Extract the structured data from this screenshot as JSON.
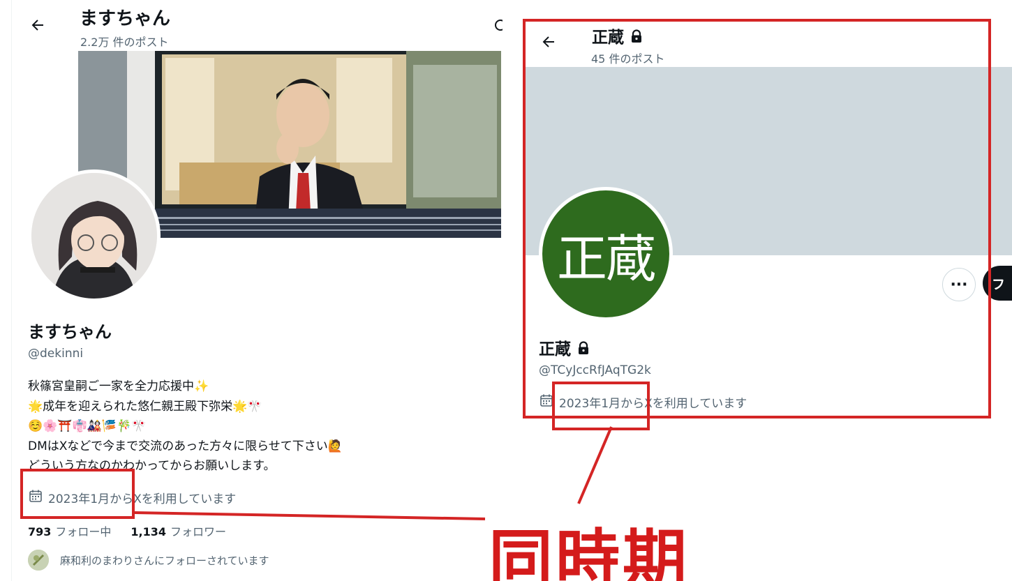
{
  "left_profile": {
    "header": {
      "name": "ますちゃん",
      "post_count": "2.2万 件のポスト"
    },
    "display_name": "ますちゃん",
    "handle": "@dekinni",
    "bio_lines": [
      "秋篠宮皇嗣ご一家を全力応援中✨",
      "🌟成年を迎えられた悠仁親王殿下弥栄🌟🎌",
      "☺️🌸⛩️👘🎎🎏🎋🎌",
      "DMはXなどで今まで交流のあった方々に限らせて下さい🙋",
      "どういう方なのかわかってからお願いします。"
    ],
    "joined": "2023年1月からXを利用しています",
    "following_count": "793",
    "following_label": "フォロー中",
    "followers_count": "1,134",
    "followers_label": "フォロワー",
    "followed_by": "麻和利のまわりさんにフォローされています"
  },
  "right_profile": {
    "header": {
      "name": "正蔵",
      "post_count": "45 件のポスト"
    },
    "avatar_text": "正蔵",
    "display_name": "正蔵",
    "handle": "@TCyJccRfJAqTG2k",
    "joined": "2023年1月からXを利用しています",
    "follow_button_partial": "フ"
  },
  "annotation": {
    "text": "同時期",
    "color": "#d42525"
  },
  "colors": {
    "text_primary": "#0f1419",
    "text_secondary": "#536471",
    "banner_gray": "#cfd9de",
    "avatar_green": "#2e6b1e"
  },
  "icons": [
    "back-arrow-icon",
    "lock-icon",
    "calendar-icon",
    "more-icon",
    "search-icon"
  ]
}
